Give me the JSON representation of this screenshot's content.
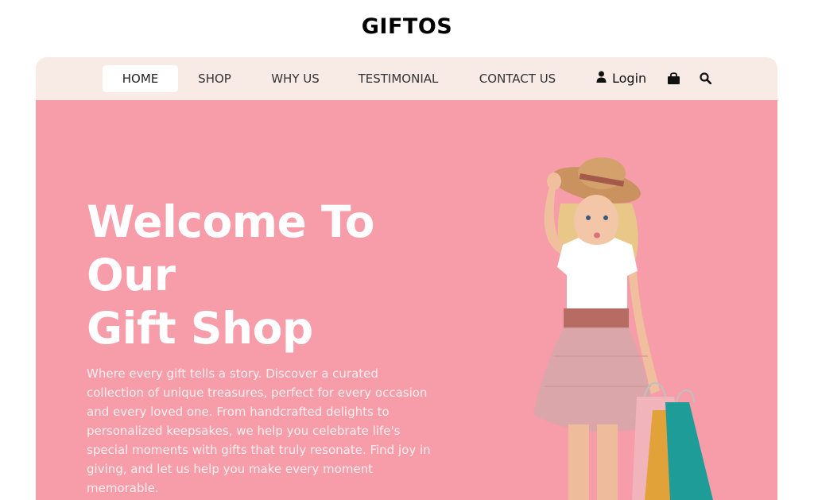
{
  "brand": {
    "name": "GIFTOS"
  },
  "nav": {
    "items": [
      {
        "label": "HOME",
        "active": true
      },
      {
        "label": "SHOP",
        "active": false
      },
      {
        "label": "WHY US",
        "active": false
      },
      {
        "label": "TESTIMONIAL",
        "active": false
      },
      {
        "label": "CONTACT US",
        "active": false
      }
    ],
    "login_label": "Login",
    "icons": [
      "user-icon",
      "shopping-bag-icon",
      "search-icon"
    ]
  },
  "hero": {
    "title_lines": [
      "Welcome To",
      "Our",
      "Gift Shop"
    ],
    "description": "Where every gift tells a story. Discover a curated collection of unique treasures, perfect for every occasion and every loved one. From handcrafted delights to personalized keepsakes, we help you celebrate life's special moments with gifts that truly resonate. Find joy in giving, and let us help you make every moment memorable.",
    "image": "girl-with-shopping-bags-photo"
  },
  "colors": {
    "hero_background": "#f79ca9",
    "nav_background": "#f8ebe6",
    "text_white": "#ffffff"
  }
}
